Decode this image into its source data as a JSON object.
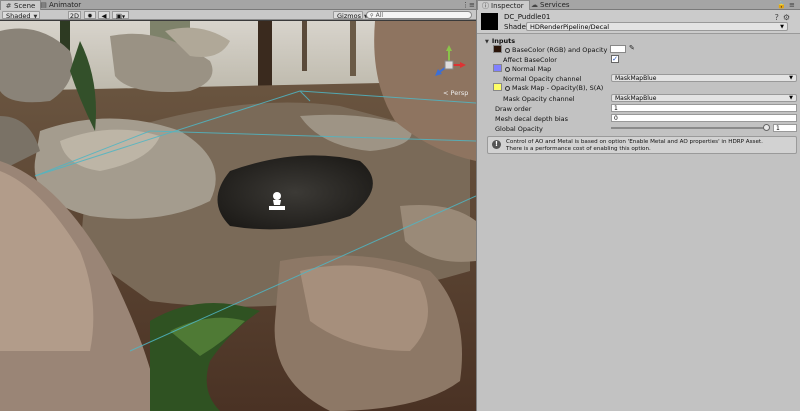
{
  "scene_tabs": {
    "scene_label": "Scene",
    "animator_label": "Animator",
    "menu_glyph": "⋮≡"
  },
  "scene_toolbar": {
    "shading_mode": "Shaded",
    "mode_2d": "2D",
    "gizmos_label": "Gizmos",
    "search_placeholder": "All",
    "search_icon": "Q-icon"
  },
  "viewport": {
    "projection_label": "< Persp"
  },
  "inspector_tabs": {
    "inspector_label": "Inspector",
    "services_label": "Services"
  },
  "material": {
    "name": "DC_Puddle01",
    "shader_label": "Shader",
    "shader_value": "HDRenderPipeline/Decal",
    "swatch_color": "#000000"
  },
  "inputs": {
    "title": "Inputs",
    "base_color_label": "BaseColor (RGB) and Opacity (A)",
    "base_color_slot_color": "#2a1408",
    "affect_base_color_label": "Affect BaseColor",
    "affect_base_color_checked": true,
    "normal_map_label": "Normal Map",
    "normal_map_slot_color": "#8080ff",
    "normal_opacity_label": "Normal Opacity channel",
    "normal_opacity_value": "MaskMapBlue",
    "mask_map_label": "Mask Map - Opacity(B), S(A)",
    "mask_map_slot_color": "#ffff66",
    "mask_opacity_label": "Mask Opacity channel",
    "mask_opacity_value": "MaskMapBlue",
    "draw_order_label": "Draw order",
    "draw_order_value": "1",
    "depth_bias_label": "Mesh decal depth bias",
    "depth_bias_value": "0",
    "global_opacity_label": "Global Opacity",
    "global_opacity_value": "1"
  },
  "help": {
    "line1": "Control of AO and Metal is based on option 'Enable Metal and AO properties' in HDRP Asset.",
    "line2": "There is a performance cost of enabling this option."
  }
}
